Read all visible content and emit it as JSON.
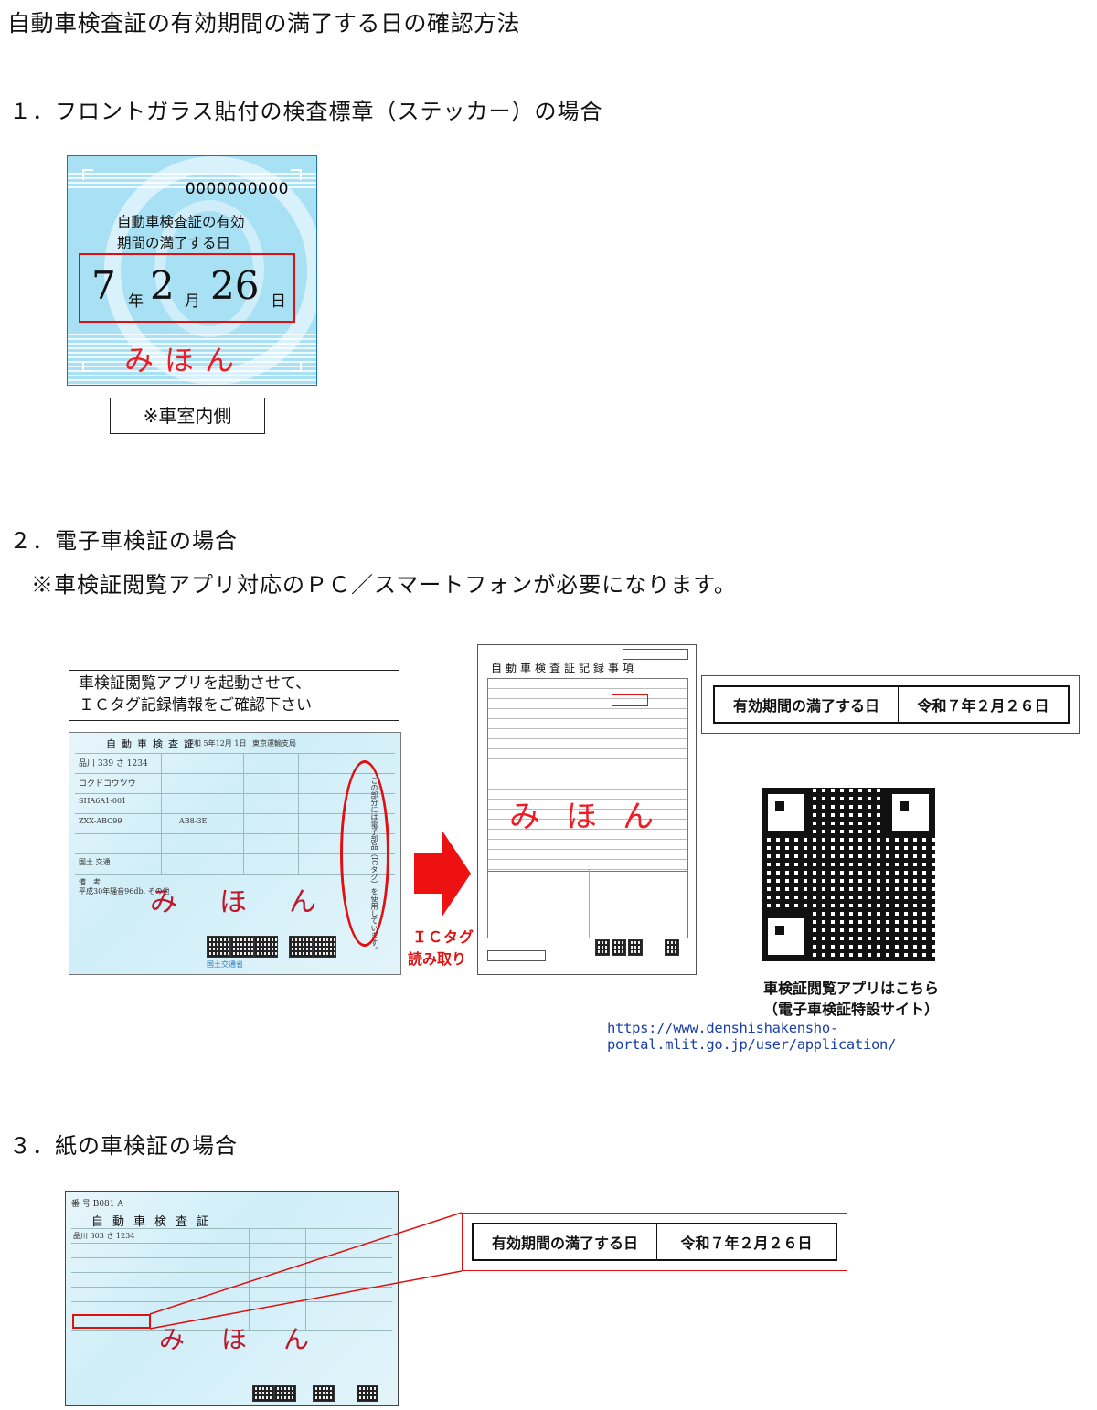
{
  "document": {
    "title": "自動車検査証の有効期間の満了する日の確認方法"
  },
  "section1": {
    "heading": "１．フロントガラス貼付の検査標章（ステッカー）の場合",
    "sticker": {
      "serial": "0000000000",
      "label_line1": "自動車検査証の有効",
      "label_line2": "期間の満了する日",
      "year": "7",
      "year_unit": "年",
      "month": "2",
      "month_unit": "月",
      "day": "26",
      "day_unit": "日",
      "sample": "みほん"
    },
    "note": "※車室内側"
  },
  "section2": {
    "heading": "２．電子車検証の場合",
    "note": "※車検証閲覧アプリ対応のＰＣ／スマートフォンが必要になります。",
    "instruction_line1": "車検証閲覧アプリを起動させて、",
    "instruction_line2": "ＩＣタグ記録情報をご確認下さい",
    "ecert": {
      "title": "自動車検査証",
      "date_line": "令和 5年12月 1日",
      "office": "東京運輸支局",
      "plate": "品川 339 さ 1234",
      "maker": "コクドコウツウ",
      "model": "SHA6A1-001",
      "chassis": "ZXX-ABC99",
      "engine": "AB8-3E",
      "owner": "国土 交通",
      "notes_label": "備　考",
      "notes_line": "平成30年騒音96db, その他",
      "chip_text": "この部分には電子部品（ICタグ）を使用しています。",
      "sample": "みほん",
      "footer": "国土交通省"
    },
    "ic_label_line1": "ＩＣタグ",
    "ic_label_line2": "読み取り",
    "record": {
      "title": "自動車検査証記録事項",
      "sample": "みほん"
    },
    "expiry": {
      "label": "有効期間の満了する日",
      "value": "令和７年２月２６日"
    },
    "qr": {
      "caption_line1": "車検証閲覧アプリはこちら",
      "caption_line2": "（電子車検証特設サイト）",
      "url": "https://www.denshishakensho-portal.mlit.go.jp/user/application/"
    }
  },
  "section3": {
    "heading": "３．紙の車検証の場合",
    "paper": {
      "number": "番 号 B081 A",
      "title": "自動車検査証",
      "plate": "品川 303 さ 1234",
      "sample": "みほん"
    },
    "expiry": {
      "label": "有効期間の満了する日",
      "value": "令和７年２月２６日"
    }
  },
  "colors": {
    "accent_red": "#e01010",
    "sticker_blue": "#a9e1f4",
    "link_blue": "#1a3fa8"
  }
}
